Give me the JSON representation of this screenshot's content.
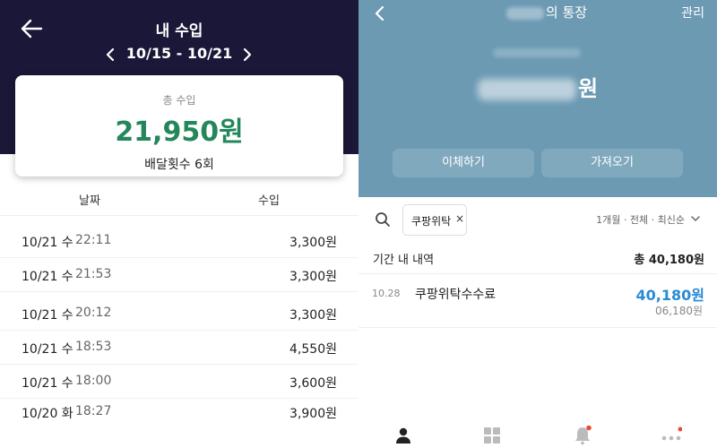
{
  "left": {
    "title": "내 수입",
    "week_range": "10/15 - 10/21",
    "summary": {
      "label": "총 수입",
      "amount": "21,950원",
      "delivery_count": "배달횟수 6회"
    },
    "columns": {
      "date": "날짜",
      "income": "수입"
    },
    "rows": [
      {
        "date": "10/21 수",
        "time": "22:11",
        "amount": "3,300원"
      },
      {
        "date": "10/21 수",
        "time": "21:53",
        "amount": "3,300원"
      },
      {
        "date": "10/21 수",
        "time": "20:12",
        "amount": "3,300원"
      },
      {
        "date": "10/21 수",
        "time": "18:53",
        "amount": "4,550원"
      },
      {
        "date": "10/21 수",
        "time": "18:00",
        "amount": "3,600원"
      },
      {
        "date": "10/20 화",
        "time": "18:27",
        "amount": "3,900원"
      }
    ],
    "colors": {
      "header_bg": "#1a1738",
      "amount_green": "#23875b"
    }
  },
  "right": {
    "title_suffix": "의 통장",
    "manage_label": "관리",
    "balance_suffix": "원",
    "buttons": {
      "transfer": "이체하기",
      "fetch": "가져오기"
    },
    "search_chip": "쿠팡위탁",
    "chip_remove": "×",
    "filter_summary": "1개월 · 전체 · 최신순",
    "period_label": "기간 내 내역",
    "period_total": "총 40,180원",
    "transaction": {
      "date": "10.28",
      "name": "쿠팡위탁수수료",
      "amount": "40,180원",
      "balance": "06,180원"
    },
    "tabs": [
      "person-icon",
      "grid-icon",
      "bell-icon",
      "more-icon"
    ],
    "colors": {
      "header_bg": "#6c9ab3",
      "amount_blue": "#2a8ad4",
      "badge_red": "#e74c3c"
    }
  }
}
